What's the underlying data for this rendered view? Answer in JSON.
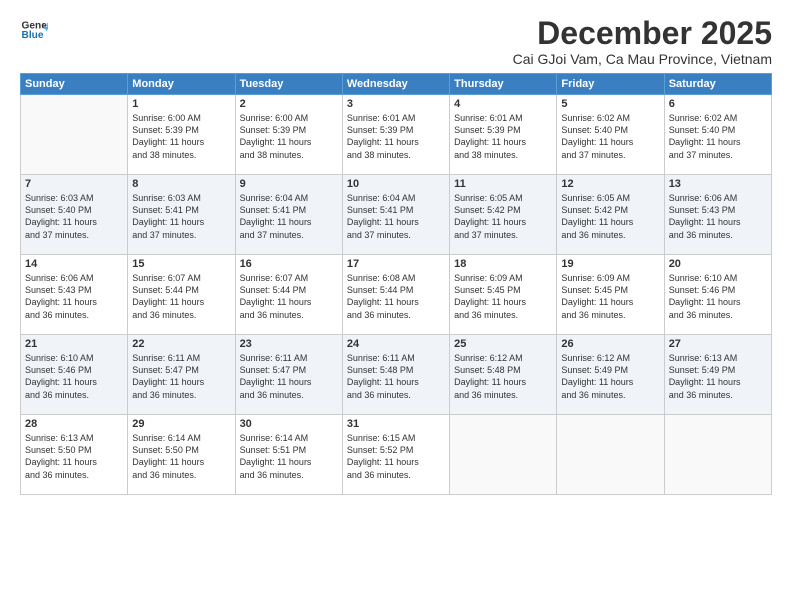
{
  "logo": {
    "line1": "General",
    "line2": "Blue"
  },
  "title": "December 2025",
  "location": "Cai GJoi Vam, Ca Mau Province, Vietnam",
  "days_of_week": [
    "Sunday",
    "Monday",
    "Tuesday",
    "Wednesday",
    "Thursday",
    "Friday",
    "Saturday"
  ],
  "weeks": [
    [
      {
        "day": "",
        "sunrise": "",
        "sunset": "",
        "daylight": ""
      },
      {
        "day": "1",
        "sunrise": "Sunrise: 6:00 AM",
        "sunset": "Sunset: 5:39 PM",
        "daylight": "Daylight: 11 hours and 38 minutes."
      },
      {
        "day": "2",
        "sunrise": "Sunrise: 6:00 AM",
        "sunset": "Sunset: 5:39 PM",
        "daylight": "Daylight: 11 hours and 38 minutes."
      },
      {
        "day": "3",
        "sunrise": "Sunrise: 6:01 AM",
        "sunset": "Sunset: 5:39 PM",
        "daylight": "Daylight: 11 hours and 38 minutes."
      },
      {
        "day": "4",
        "sunrise": "Sunrise: 6:01 AM",
        "sunset": "Sunset: 5:39 PM",
        "daylight": "Daylight: 11 hours and 38 minutes."
      },
      {
        "day": "5",
        "sunrise": "Sunrise: 6:02 AM",
        "sunset": "Sunset: 5:40 PM",
        "daylight": "Daylight: 11 hours and 37 minutes."
      },
      {
        "day": "6",
        "sunrise": "Sunrise: 6:02 AM",
        "sunset": "Sunset: 5:40 PM",
        "daylight": "Daylight: 11 hours and 37 minutes."
      }
    ],
    [
      {
        "day": "7",
        "sunrise": "Sunrise: 6:03 AM",
        "sunset": "Sunset: 5:40 PM",
        "daylight": "Daylight: 11 hours and 37 minutes."
      },
      {
        "day": "8",
        "sunrise": "Sunrise: 6:03 AM",
        "sunset": "Sunset: 5:41 PM",
        "daylight": "Daylight: 11 hours and 37 minutes."
      },
      {
        "day": "9",
        "sunrise": "Sunrise: 6:04 AM",
        "sunset": "Sunset: 5:41 PM",
        "daylight": "Daylight: 11 hours and 37 minutes."
      },
      {
        "day": "10",
        "sunrise": "Sunrise: 6:04 AM",
        "sunset": "Sunset: 5:41 PM",
        "daylight": "Daylight: 11 hours and 37 minutes."
      },
      {
        "day": "11",
        "sunrise": "Sunrise: 6:05 AM",
        "sunset": "Sunset: 5:42 PM",
        "daylight": "Daylight: 11 hours and 37 minutes."
      },
      {
        "day": "12",
        "sunrise": "Sunrise: 6:05 AM",
        "sunset": "Sunset: 5:42 PM",
        "daylight": "Daylight: 11 hours and 36 minutes."
      },
      {
        "day": "13",
        "sunrise": "Sunrise: 6:06 AM",
        "sunset": "Sunset: 5:43 PM",
        "daylight": "Daylight: 11 hours and 36 minutes."
      }
    ],
    [
      {
        "day": "14",
        "sunrise": "Sunrise: 6:06 AM",
        "sunset": "Sunset: 5:43 PM",
        "daylight": "Daylight: 11 hours and 36 minutes."
      },
      {
        "day": "15",
        "sunrise": "Sunrise: 6:07 AM",
        "sunset": "Sunset: 5:44 PM",
        "daylight": "Daylight: 11 hours and 36 minutes."
      },
      {
        "day": "16",
        "sunrise": "Sunrise: 6:07 AM",
        "sunset": "Sunset: 5:44 PM",
        "daylight": "Daylight: 11 hours and 36 minutes."
      },
      {
        "day": "17",
        "sunrise": "Sunrise: 6:08 AM",
        "sunset": "Sunset: 5:44 PM",
        "daylight": "Daylight: 11 hours and 36 minutes."
      },
      {
        "day": "18",
        "sunrise": "Sunrise: 6:09 AM",
        "sunset": "Sunset: 5:45 PM",
        "daylight": "Daylight: 11 hours and 36 minutes."
      },
      {
        "day": "19",
        "sunrise": "Sunrise: 6:09 AM",
        "sunset": "Sunset: 5:45 PM",
        "daylight": "Daylight: 11 hours and 36 minutes."
      },
      {
        "day": "20",
        "sunrise": "Sunrise: 6:10 AM",
        "sunset": "Sunset: 5:46 PM",
        "daylight": "Daylight: 11 hours and 36 minutes."
      }
    ],
    [
      {
        "day": "21",
        "sunrise": "Sunrise: 6:10 AM",
        "sunset": "Sunset: 5:46 PM",
        "daylight": "Daylight: 11 hours and 36 minutes."
      },
      {
        "day": "22",
        "sunrise": "Sunrise: 6:11 AM",
        "sunset": "Sunset: 5:47 PM",
        "daylight": "Daylight: 11 hours and 36 minutes."
      },
      {
        "day": "23",
        "sunrise": "Sunrise: 6:11 AM",
        "sunset": "Sunset: 5:47 PM",
        "daylight": "Daylight: 11 hours and 36 minutes."
      },
      {
        "day": "24",
        "sunrise": "Sunrise: 6:11 AM",
        "sunset": "Sunset: 5:48 PM",
        "daylight": "Daylight: 11 hours and 36 minutes."
      },
      {
        "day": "25",
        "sunrise": "Sunrise: 6:12 AM",
        "sunset": "Sunset: 5:48 PM",
        "daylight": "Daylight: 11 hours and 36 minutes."
      },
      {
        "day": "26",
        "sunrise": "Sunrise: 6:12 AM",
        "sunset": "Sunset: 5:49 PM",
        "daylight": "Daylight: 11 hours and 36 minutes."
      },
      {
        "day": "27",
        "sunrise": "Sunrise: 6:13 AM",
        "sunset": "Sunset: 5:49 PM",
        "daylight": "Daylight: 11 hours and 36 minutes."
      }
    ],
    [
      {
        "day": "28",
        "sunrise": "Sunrise: 6:13 AM",
        "sunset": "Sunset: 5:50 PM",
        "daylight": "Daylight: 11 hours and 36 minutes."
      },
      {
        "day": "29",
        "sunrise": "Sunrise: 6:14 AM",
        "sunset": "Sunset: 5:50 PM",
        "daylight": "Daylight: 11 hours and 36 minutes."
      },
      {
        "day": "30",
        "sunrise": "Sunrise: 6:14 AM",
        "sunset": "Sunset: 5:51 PM",
        "daylight": "Daylight: 11 hours and 36 minutes."
      },
      {
        "day": "31",
        "sunrise": "Sunrise: 6:15 AM",
        "sunset": "Sunset: 5:52 PM",
        "daylight": "Daylight: 11 hours and 36 minutes."
      },
      {
        "day": "",
        "sunrise": "",
        "sunset": "",
        "daylight": ""
      },
      {
        "day": "",
        "sunrise": "",
        "sunset": "",
        "daylight": ""
      },
      {
        "day": "",
        "sunrise": "",
        "sunset": "",
        "daylight": ""
      }
    ]
  ]
}
